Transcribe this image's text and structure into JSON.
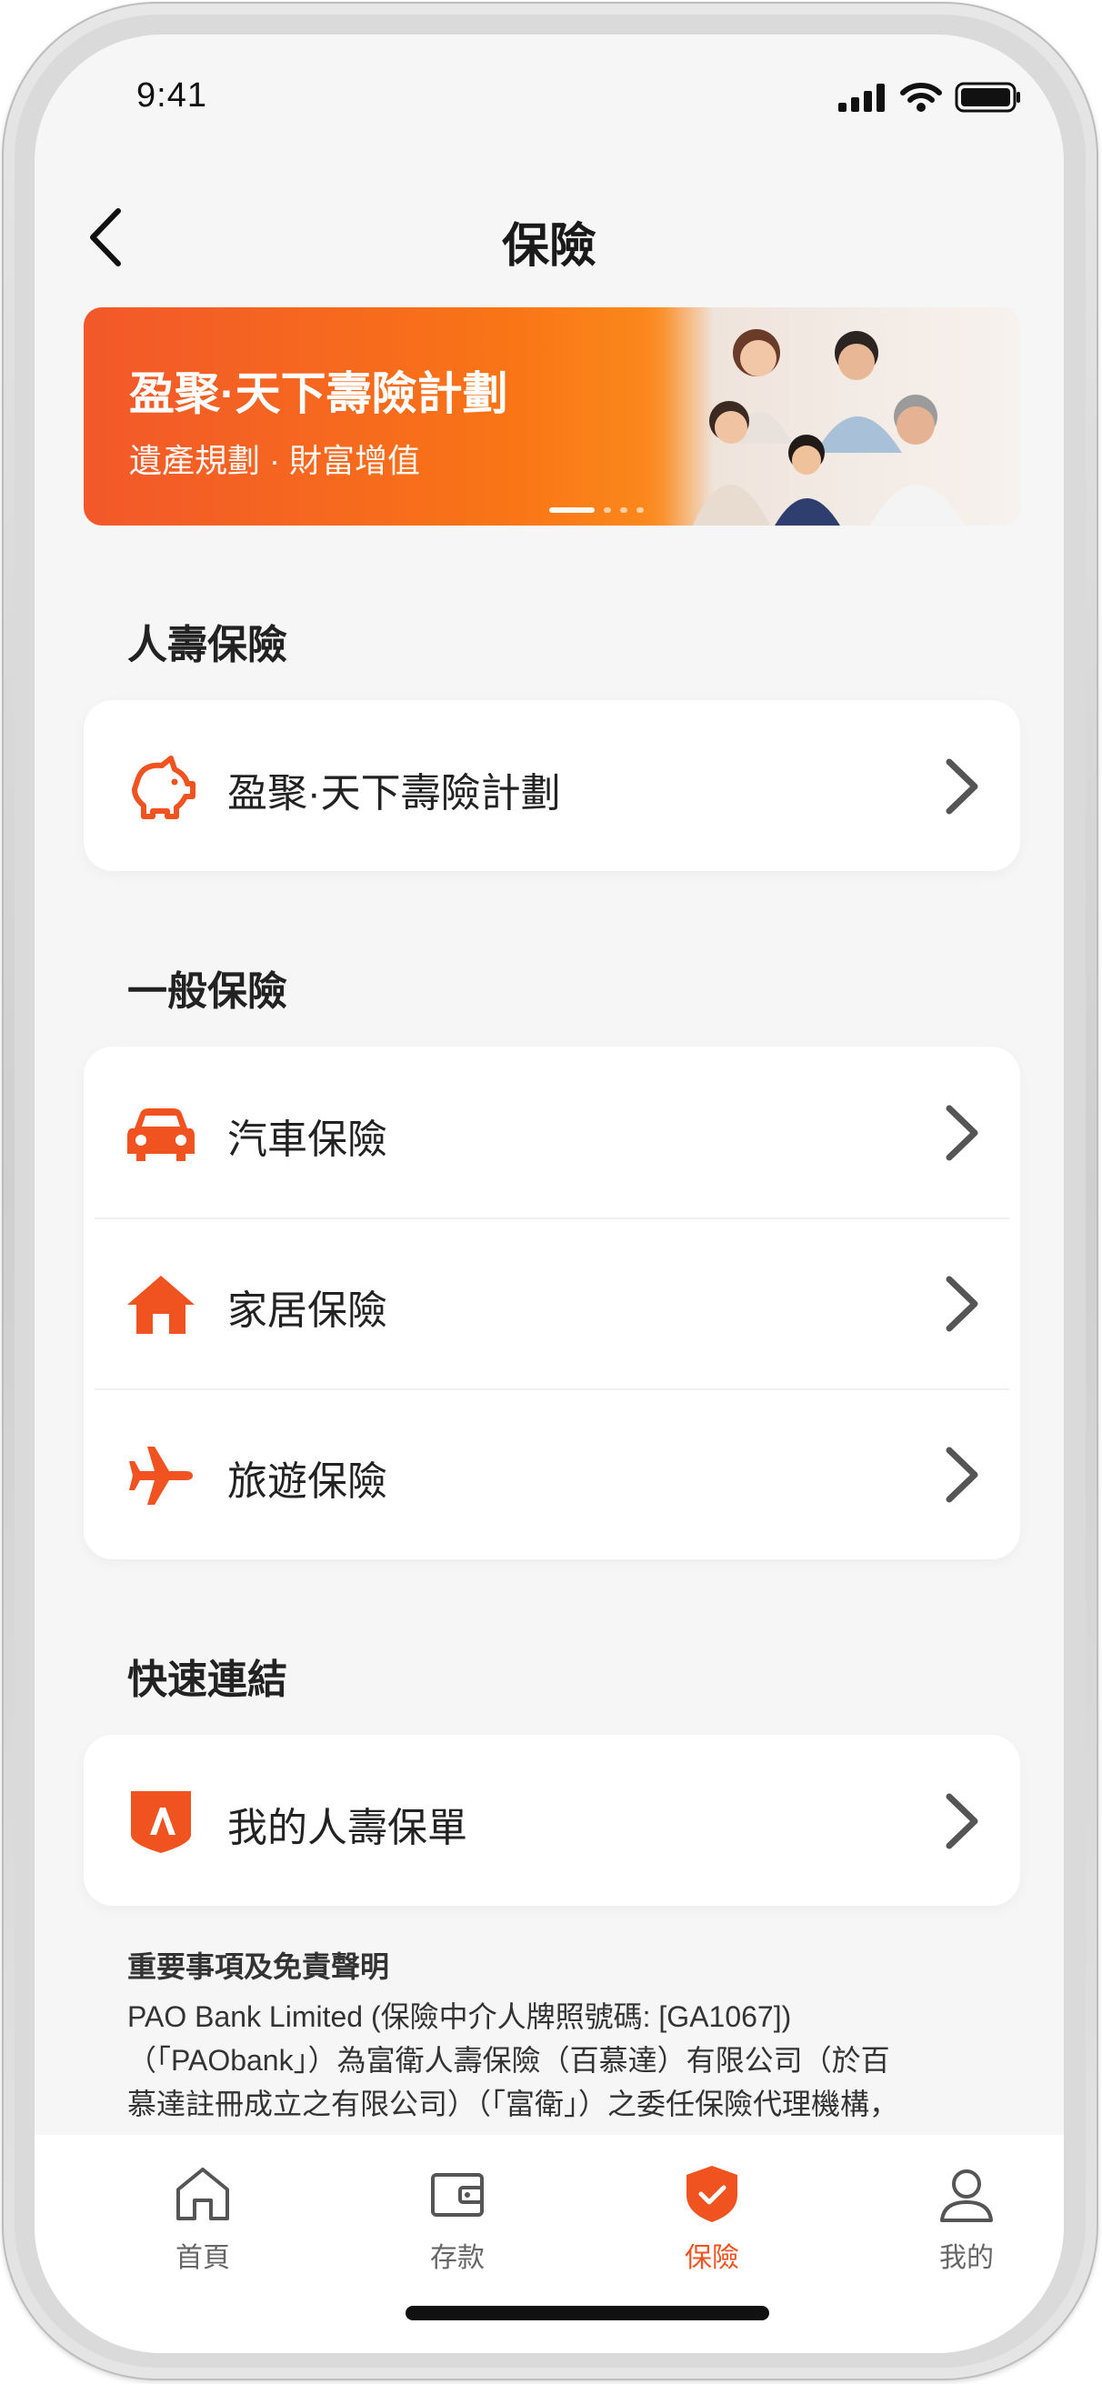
{
  "status_bar": {
    "time": "9:41"
  },
  "header": {
    "title": "保險"
  },
  "banner": {
    "title": "盈聚·天下壽險計劃",
    "subtitle": "遺產規劃 · 財富增值",
    "dots": 4,
    "active_dot": 1
  },
  "sections": {
    "life": {
      "title": "人壽保險",
      "items": [
        {
          "label": "盈聚·天下壽險計劃",
          "icon": "piggy-bank-icon"
        }
      ]
    },
    "general": {
      "title": "一般保險",
      "items": [
        {
          "label": "汽車保險",
          "icon": "car-icon"
        },
        {
          "label": "家居保險",
          "icon": "house-icon"
        },
        {
          "label": "旅遊保險",
          "icon": "airplane-icon"
        }
      ]
    },
    "quick": {
      "title": "快速連結",
      "items": [
        {
          "label": "我的人壽保單",
          "icon": "fwd-logo-icon"
        }
      ]
    }
  },
  "disclaimer": {
    "title": "重要事項及免責聲明",
    "lines": [
      "PAO Bank Limited (保險中介人牌照號碼: [GA1067])",
      "（「PAObank」）為富衛人壽保險（百慕達）有限公司（於百",
      "慕達註冊成立之有限公司）（「富衛」）之委任保險代理機構，"
    ]
  },
  "tab_bar": {
    "tabs": [
      {
        "label": "首頁",
        "icon": "home-icon",
        "active": false
      },
      {
        "label": "存款",
        "icon": "wallet-icon",
        "active": false
      },
      {
        "label": "保險",
        "icon": "shield-check-icon",
        "active": true
      },
      {
        "label": "我的",
        "icon": "person-icon",
        "active": false
      }
    ]
  },
  "colors": {
    "accent": "#f0531f",
    "background": "#f6f6f6",
    "chevron": "#555555"
  }
}
